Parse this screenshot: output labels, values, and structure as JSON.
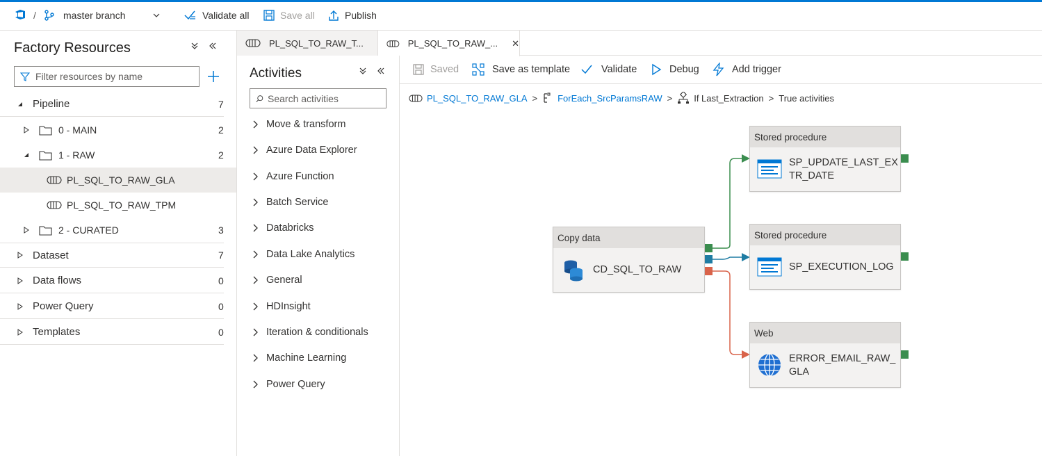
{
  "topbar": {
    "separator": "/",
    "branch": "master branch",
    "validate_all": "Validate all",
    "save_all": "Save all",
    "publish": "Publish"
  },
  "factory": {
    "title": "Factory Resources",
    "filter_placeholder": "Filter resources by name",
    "tree": {
      "pipeline": {
        "label": "Pipeline",
        "count": "7"
      },
      "main": {
        "label": "0 - MAIN",
        "count": "2"
      },
      "raw": {
        "label": "1 - RAW",
        "count": "2"
      },
      "pl_gla": {
        "label": "PL_SQL_TO_RAW_GLA"
      },
      "pl_tpm": {
        "label": "PL_SQL_TO_RAW_TPM"
      },
      "curated": {
        "label": "2 - CURATED",
        "count": "3"
      },
      "dataset": {
        "label": "Dataset",
        "count": "7"
      },
      "dataflows": {
        "label": "Data flows",
        "count": "0"
      },
      "powerquery": {
        "label": "Power Query",
        "count": "0"
      },
      "templates": {
        "label": "Templates",
        "count": "0"
      }
    }
  },
  "tabs": [
    {
      "label": "PL_SQL_TO_RAW_T..."
    },
    {
      "label": "PL_SQL_TO_RAW_...",
      "close": "✕"
    }
  ],
  "activities": {
    "title": "Activities",
    "search_placeholder": "Search activities",
    "items": [
      "Move & transform",
      "Azure Data Explorer",
      "Azure Function",
      "Batch Service",
      "Databricks",
      "Data Lake Analytics",
      "General",
      "HDInsight",
      "Iteration & conditionals",
      "Machine Learning",
      "Power Query"
    ]
  },
  "canvas_toolbar": {
    "saved": "Saved",
    "save_template": "Save as template",
    "validate": "Validate",
    "debug": "Debug",
    "add_trigger": "Add trigger"
  },
  "breadcrumb": {
    "pipeline": "PL_SQL_TO_RAW_GLA",
    "foreach": "ForEach_SrcParamsRAW",
    "if_activity": "If Last_Extraction",
    "current": "True activities",
    "sep": ">"
  },
  "nodes": {
    "copy": {
      "type": "Copy data",
      "name": "CD_SQL_TO_RAW"
    },
    "sp_update": {
      "type": "Stored procedure",
      "name": "SP_UPDATE_LAST_EXTR_DATE"
    },
    "sp_log": {
      "type": "Stored procedure",
      "name": "SP_EXECUTION_LOG"
    },
    "web": {
      "type": "Web",
      "name": "ERROR_EMAIL_RAW_GLA"
    }
  },
  "colors": {
    "accent": "#0078d4",
    "success": "#3b8d4f",
    "completion": "#1f7ca3",
    "failure": "#d9634a"
  }
}
